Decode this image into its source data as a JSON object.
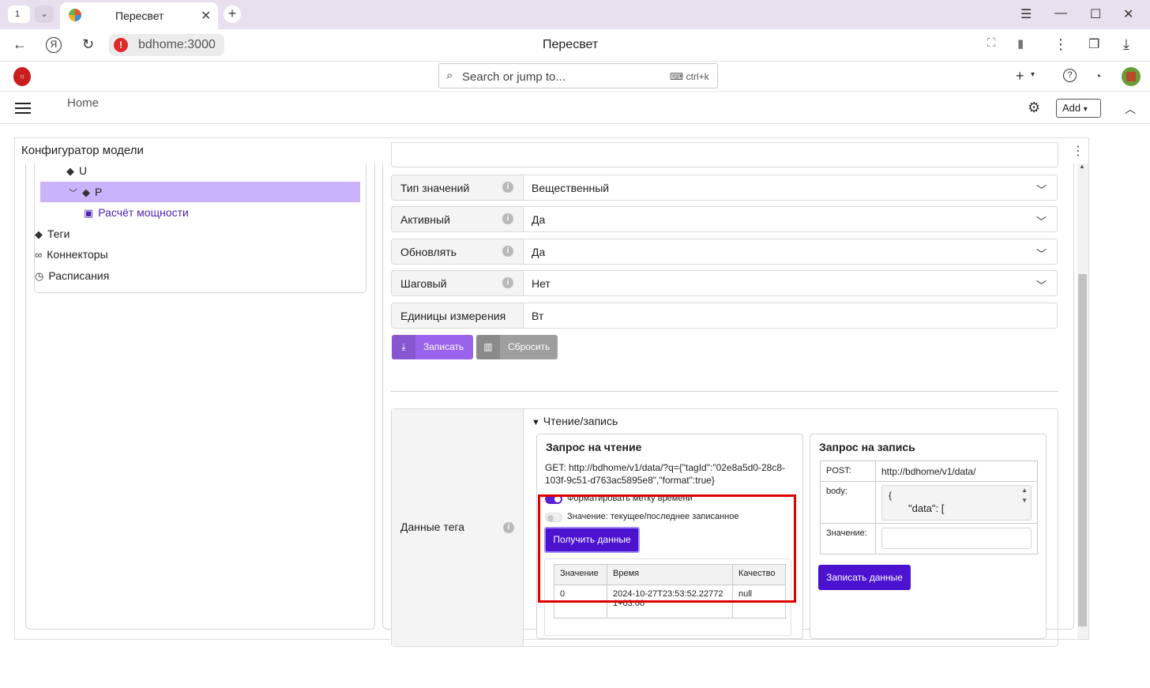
{
  "browser": {
    "tab_count": "1",
    "tab_title": "Пересвет",
    "url_host": "bdhome:3000",
    "page_title": "Пересвет"
  },
  "header": {
    "search_placeholder": "Search or jump to...",
    "search_shortcut": "ctrl+k"
  },
  "subheader": {
    "breadcrumb_home": "Home",
    "add_label": "Add"
  },
  "panel": {
    "title": "Конфигуратор модели"
  },
  "tree": {
    "items": [
      {
        "label": "U"
      },
      {
        "label": "P"
      },
      {
        "label": "Расчёт мощности"
      },
      {
        "label": "Теги"
      },
      {
        "label": "Коннекторы"
      },
      {
        "label": "Расписания"
      }
    ]
  },
  "form": {
    "rows": [
      {
        "label": "Тип значений",
        "value": "Вещественный"
      },
      {
        "label": "Активный",
        "value": "Да"
      },
      {
        "label": "Обновлять",
        "value": "Да"
      },
      {
        "label": "Шаговый",
        "value": "Нет"
      },
      {
        "label": "Единицы измерения",
        "value": "Вт"
      }
    ],
    "save_label": "Записать",
    "reset_label": "Сбросить",
    "tag_data_label": "Данные тега",
    "section_label": "Чтение/запись"
  },
  "read": {
    "title": "Запрос на чтение",
    "request_text": "GET:  http://bdhome/v1/data/?q={\"tagId\":\"02e8a5d0-28c8-103f-9c51-d763ac5895e8\",\"format\":true}",
    "toggle_format_label": "Форматировать метку времени",
    "toggle_value_label": "Значение: текущее/последнее записанное",
    "get_button_label": "Получить данные",
    "table": {
      "headers": [
        "Значение",
        "Время",
        "Качество"
      ],
      "rows": [
        [
          "0",
          "2024-10-27T23:53:52.227721+03:00",
          "null"
        ]
      ]
    }
  },
  "write": {
    "title": "Запрос на запись",
    "post_key": "POST:",
    "post_value": "http://bdhome/v1/data/",
    "body_key": "body:",
    "body_line1": "{",
    "body_line2": "\"data\": [",
    "value_key": "Значение:",
    "write_button_label": "Записать данные"
  },
  "colors": {
    "accent": "#5b1fd6",
    "selection": "#c9b3fb",
    "save_button": "#9a63ec",
    "reset_button": "#9e9e9e",
    "highlight": "#e00000"
  }
}
